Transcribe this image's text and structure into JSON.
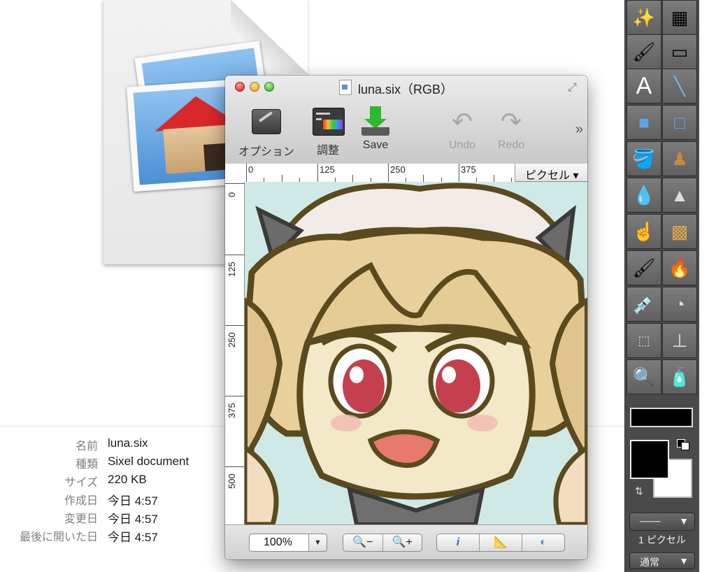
{
  "finder": {
    "info": [
      {
        "key": "名前",
        "value": "luna.six"
      },
      {
        "key": "種類",
        "value": "Sixel document"
      },
      {
        "key": "サイズ",
        "value": "220 KB"
      },
      {
        "key": "作成日",
        "value": "今日 4:57"
      },
      {
        "key": "変更日",
        "value": "今日 4:57"
      },
      {
        "key": "最後に開いた日",
        "value": "今日 4:57"
      }
    ]
  },
  "window": {
    "title": "luna.six（RGB）",
    "toolbar": {
      "options_label": "オプション",
      "adjust_label": "調整",
      "save_label": "Save",
      "undo_label": "Undo",
      "redo_label": "Redo",
      "more": "»"
    },
    "ruler": {
      "h_labels": [
        "0",
        "125",
        "250",
        "375"
      ],
      "v_labels": [
        "0",
        "125",
        "250",
        "375",
        "500"
      ],
      "unit": "ピクセル"
    },
    "status": {
      "zoom": "100%",
      "zoom_out": "−",
      "zoom_in": "+",
      "info": "i"
    }
  },
  "palette": {
    "brush_size": "1 ピクセル",
    "blend_mode": "通常",
    "foreground": "#000000",
    "background": "#ffffff"
  }
}
